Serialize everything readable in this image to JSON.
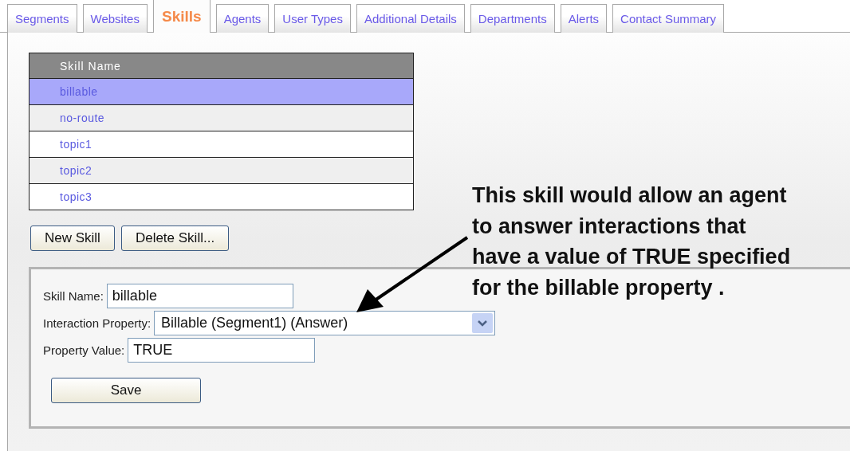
{
  "tabs": [
    {
      "label": "Segments",
      "selected": false
    },
    {
      "label": "Websites",
      "selected": false
    },
    {
      "label": "Skills",
      "selected": true
    },
    {
      "label": "Agents",
      "selected": false
    },
    {
      "label": "User Types",
      "selected": false
    },
    {
      "label": "Additional Details",
      "selected": false
    },
    {
      "label": "Departments",
      "selected": false
    },
    {
      "label": "Alerts",
      "selected": false
    },
    {
      "label": "Contact Summary",
      "selected": false
    }
  ],
  "skills_table": {
    "columns": [
      "Skill Name"
    ],
    "rows": [
      {
        "name": "billable",
        "selected": true
      },
      {
        "name": "no-route",
        "selected": false
      },
      {
        "name": "topic1",
        "selected": false
      },
      {
        "name": "topic2",
        "selected": false
      },
      {
        "name": "topic3",
        "selected": false
      }
    ]
  },
  "table_buttons": [
    "New Skill",
    "Delete Skill..."
  ],
  "form": {
    "fields": [
      {
        "kind": "text",
        "label": "Skill Name:",
        "value": "billable"
      },
      {
        "kind": "select",
        "label": "Interaction Property:",
        "value": "Billable (Segment1) (Answer)"
      },
      {
        "kind": "text",
        "label": "Property Value:",
        "value": "TRUE"
      }
    ],
    "save_button": "Save"
  },
  "callout": {
    "lines": [
      "This skill would allow an agent",
      "to answer interactions that",
      "have a value of TRUE specified",
      "for the billable property ."
    ]
  }
}
